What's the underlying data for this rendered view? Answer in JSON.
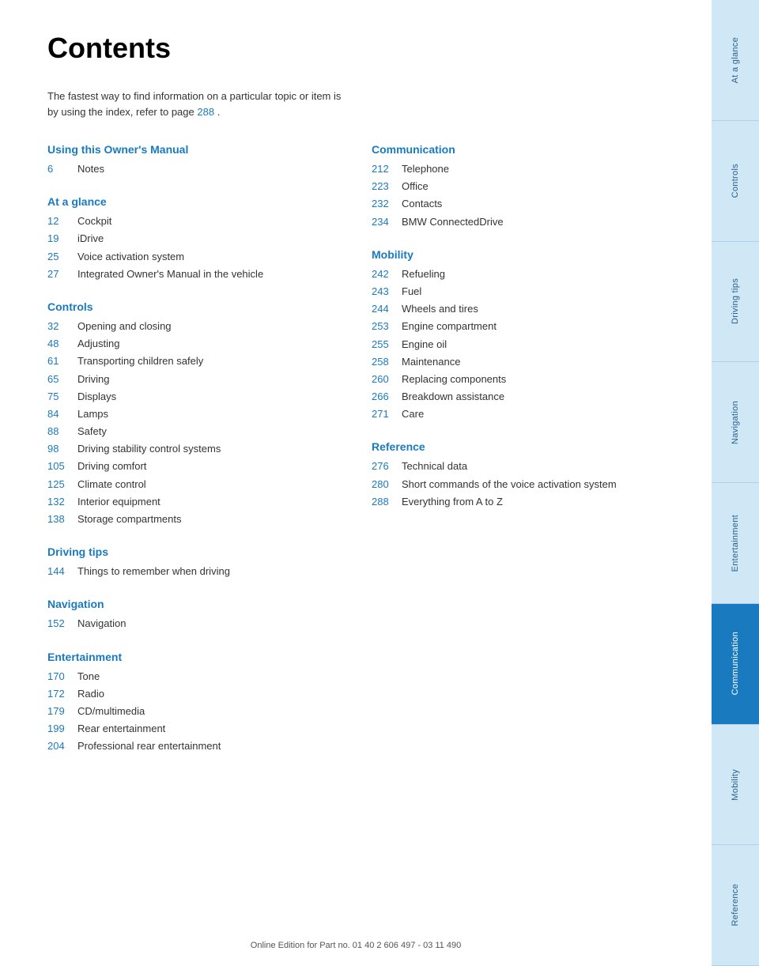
{
  "page": {
    "title": "Contents",
    "intro": "The fastest way to find information on a particular topic or item is by using the index, refer to page",
    "intro_link": "288",
    "intro_end": ".",
    "footer": "Online Edition for Part no. 01 40 2 606 497 - 03 11 490"
  },
  "sections": [
    {
      "id": "using-owners-manual",
      "heading": "Using this Owner's Manual",
      "items": [
        {
          "number": "6",
          "label": "Notes"
        }
      ]
    },
    {
      "id": "at-a-glance",
      "heading": "At a glance",
      "items": [
        {
          "number": "12",
          "label": "Cockpit"
        },
        {
          "number": "19",
          "label": "iDrive"
        },
        {
          "number": "25",
          "label": "Voice activation system"
        },
        {
          "number": "27",
          "label": "Integrated Owner's Manual in the vehicle"
        }
      ]
    },
    {
      "id": "controls",
      "heading": "Controls",
      "items": [
        {
          "number": "32",
          "label": "Opening and closing"
        },
        {
          "number": "48",
          "label": "Adjusting"
        },
        {
          "number": "61",
          "label": "Transporting children safely"
        },
        {
          "number": "65",
          "label": "Driving"
        },
        {
          "number": "75",
          "label": "Displays"
        },
        {
          "number": "84",
          "label": "Lamps"
        },
        {
          "number": "88",
          "label": "Safety"
        },
        {
          "number": "98",
          "label": "Driving stability control systems"
        },
        {
          "number": "105",
          "label": "Driving comfort"
        },
        {
          "number": "125",
          "label": "Climate control"
        },
        {
          "number": "132",
          "label": "Interior equipment"
        },
        {
          "number": "138",
          "label": "Storage compartments"
        }
      ]
    },
    {
      "id": "driving-tips",
      "heading": "Driving tips",
      "items": [
        {
          "number": "144",
          "label": "Things to remember when driving"
        }
      ]
    },
    {
      "id": "navigation",
      "heading": "Navigation",
      "items": [
        {
          "number": "152",
          "label": "Navigation"
        }
      ]
    },
    {
      "id": "entertainment",
      "heading": "Entertainment",
      "items": [
        {
          "number": "170",
          "label": "Tone"
        },
        {
          "number": "172",
          "label": "Radio"
        },
        {
          "number": "179",
          "label": "CD/multimedia"
        },
        {
          "number": "199",
          "label": "Rear entertainment"
        },
        {
          "number": "204",
          "label": "Professional rear entertainment"
        }
      ]
    }
  ],
  "sections_right": [
    {
      "id": "communication",
      "heading": "Communication",
      "items": [
        {
          "number": "212",
          "label": "Telephone"
        },
        {
          "number": "223",
          "label": "Office"
        },
        {
          "number": "232",
          "label": "Contacts"
        },
        {
          "number": "234",
          "label": "BMW ConnectedDrive"
        }
      ]
    },
    {
      "id": "mobility",
      "heading": "Mobility",
      "items": [
        {
          "number": "242",
          "label": "Refueling"
        },
        {
          "number": "243",
          "label": "Fuel"
        },
        {
          "number": "244",
          "label": "Wheels and tires"
        },
        {
          "number": "253",
          "label": "Engine compartment"
        },
        {
          "number": "255",
          "label": "Engine oil"
        },
        {
          "number": "258",
          "label": "Maintenance"
        },
        {
          "number": "260",
          "label": "Replacing components"
        },
        {
          "number": "266",
          "label": "Breakdown assistance"
        },
        {
          "number": "271",
          "label": "Care"
        }
      ]
    },
    {
      "id": "reference",
      "heading": "Reference",
      "items": [
        {
          "number": "276",
          "label": "Technical data"
        },
        {
          "number": "280",
          "label": "Short commands of the voice activation system"
        },
        {
          "number": "288",
          "label": "Everything from A to Z"
        }
      ]
    }
  ],
  "sidebar": {
    "tabs": [
      {
        "id": "at-a-glance",
        "label": "At a glance",
        "active": false
      },
      {
        "id": "controls",
        "label": "Controls",
        "active": false
      },
      {
        "id": "driving-tips",
        "label": "Driving tips",
        "active": false
      },
      {
        "id": "navigation",
        "label": "Navigation",
        "active": false
      },
      {
        "id": "entertainment",
        "label": "Entertainment",
        "active": false
      },
      {
        "id": "communication",
        "label": "Communication",
        "active": true
      },
      {
        "id": "mobility",
        "label": "Mobility",
        "active": false
      },
      {
        "id": "reference",
        "label": "Reference",
        "active": false
      }
    ]
  }
}
